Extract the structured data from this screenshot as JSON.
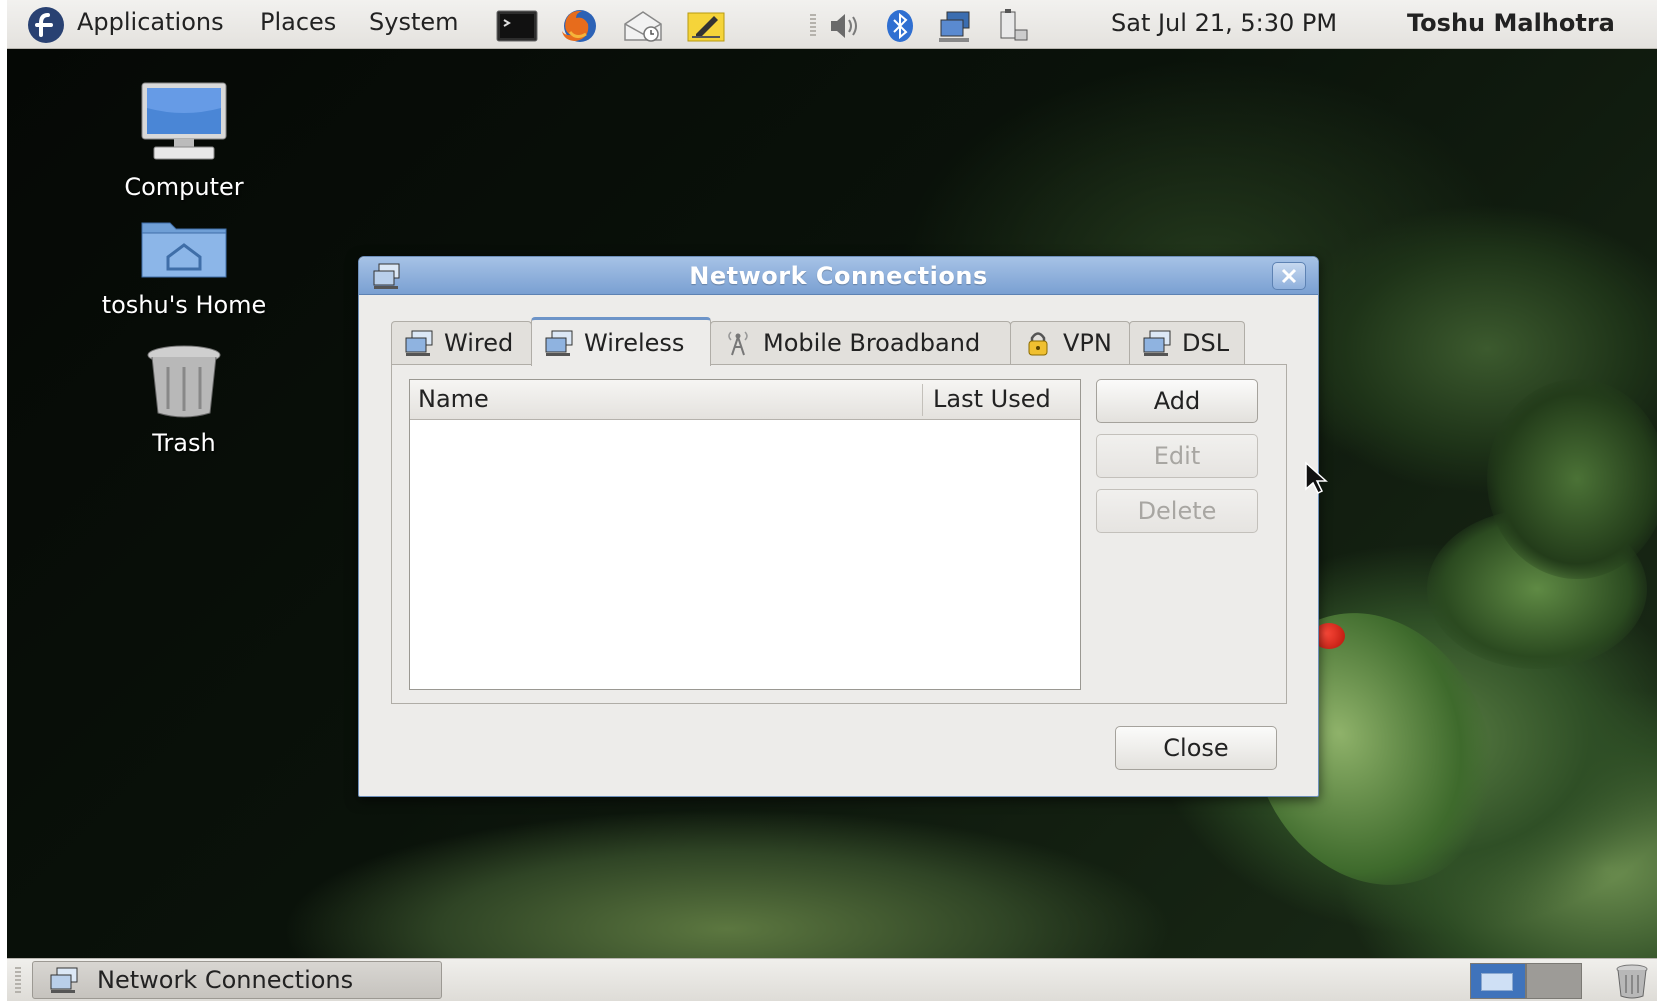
{
  "top_panel": {
    "menus": [
      "Applications",
      "Places",
      "System"
    ],
    "clock": "Sat Jul 21,  5:30 PM",
    "user": "Toshu Malhotra"
  },
  "desktop": {
    "icons": [
      {
        "label": "Computer",
        "icon": "computer-icon"
      },
      {
        "label": "toshu's Home",
        "icon": "home-folder-icon"
      },
      {
        "label": "Trash",
        "icon": "trash-icon"
      }
    ]
  },
  "dialog": {
    "title": "Network Connections",
    "tabs": [
      {
        "label": "Wired",
        "icon": "network-icon"
      },
      {
        "label": "Wireless",
        "icon": "network-icon"
      },
      {
        "label": "Mobile Broadband",
        "icon": "antenna-icon"
      },
      {
        "label": "VPN",
        "icon": "lock-icon"
      },
      {
        "label": "DSL",
        "icon": "network-icon"
      }
    ],
    "active_tab": "Wireless",
    "columns": [
      "Name",
      "Last Used"
    ],
    "rows": [],
    "buttons": {
      "add": "Add",
      "edit": "Edit",
      "delete": "Delete",
      "close": "Close"
    }
  },
  "bottom_panel": {
    "task": "Network Connections"
  },
  "colors": {
    "titlebar": "#7aa0d2",
    "dialog_bg": "#edecea",
    "panel_bg": "#e4e2de",
    "workspace_active": "#3f73bb"
  }
}
